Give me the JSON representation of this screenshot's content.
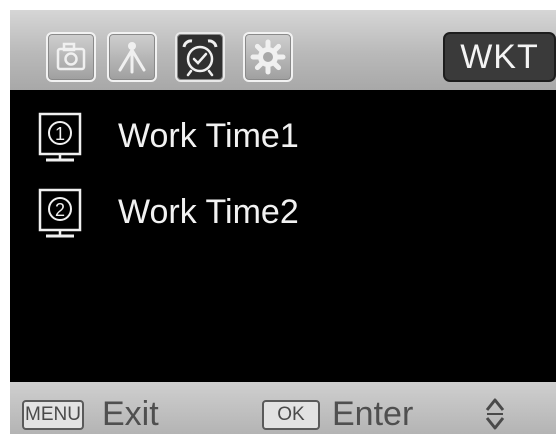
{
  "header": {
    "tabs": [
      {
        "id": "camera",
        "icon": "camera-icon",
        "active": false
      },
      {
        "id": "trigger",
        "icon": "pir-sensor-icon",
        "active": false
      },
      {
        "id": "work-time",
        "icon": "alarm-clock-icon",
        "active": true
      },
      {
        "id": "settings",
        "icon": "gear-icon",
        "active": false
      }
    ],
    "badge": "WKT"
  },
  "list": {
    "items": [
      {
        "number": "1",
        "label": "Work Time1",
        "icon": "numbered-slot-icon"
      },
      {
        "number": "2",
        "label": "Work Time2",
        "icon": "numbered-slot-icon"
      }
    ]
  },
  "footer": {
    "menu_key": "MENU",
    "exit_label": "Exit",
    "ok_key": "OK",
    "enter_label": "Enter",
    "nav_icon": "up-down-arrows-icon"
  },
  "colors": {
    "header_bg": "#bfbfbf",
    "active_tab_bg": "#2f2f2f",
    "badge_bg": "#3a3a3a",
    "list_bg": "#000000",
    "text_light": "#f2f2f2",
    "footer_bg": "#c2c2c2"
  }
}
